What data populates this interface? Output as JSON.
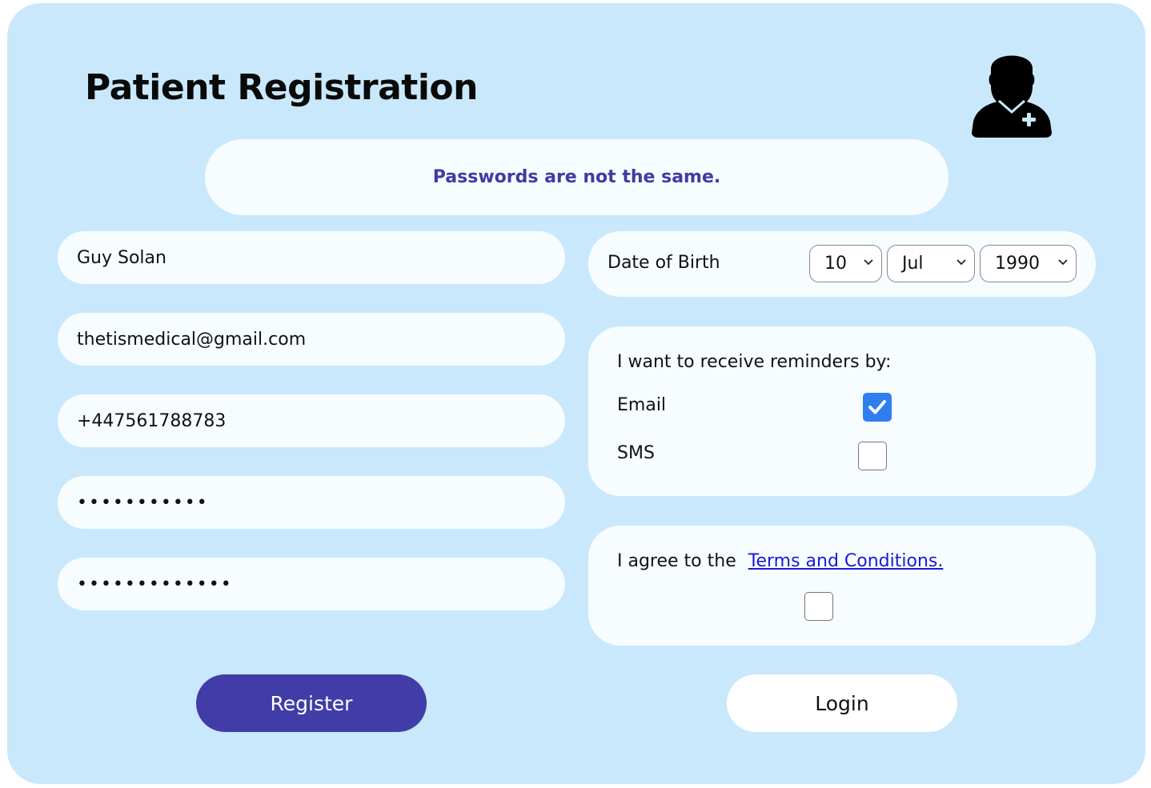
{
  "header": {
    "title": "Patient Registration",
    "avatar_icon": "doctor-avatar-icon"
  },
  "alert": {
    "message": "Passwords are not the same.",
    "color": "#3f3ba3"
  },
  "form": {
    "name": "Guy Solan",
    "email": "thetismedical@gmail.com",
    "phone": "+447561788783",
    "password_mask": "•••••••••••",
    "confirm_password_mask": "•••••••••••••"
  },
  "dob": {
    "label": "Date of Birth",
    "day": "10",
    "month": "Jul",
    "year": "1990"
  },
  "reminders": {
    "title": "I want to receive reminders by:",
    "options": [
      {
        "label": "Email",
        "checked": true
      },
      {
        "label": "SMS",
        "checked": false
      }
    ]
  },
  "terms": {
    "prefix": "I agree to the",
    "link": "Terms and Conditions.",
    "checked": false
  },
  "buttons": {
    "register": "Register",
    "login": "Login"
  },
  "colors": {
    "background": "#c9e8fb",
    "accent": "#423ca8",
    "checkbox_checked": "#2f7ef0",
    "link": "#1a1ad6"
  }
}
